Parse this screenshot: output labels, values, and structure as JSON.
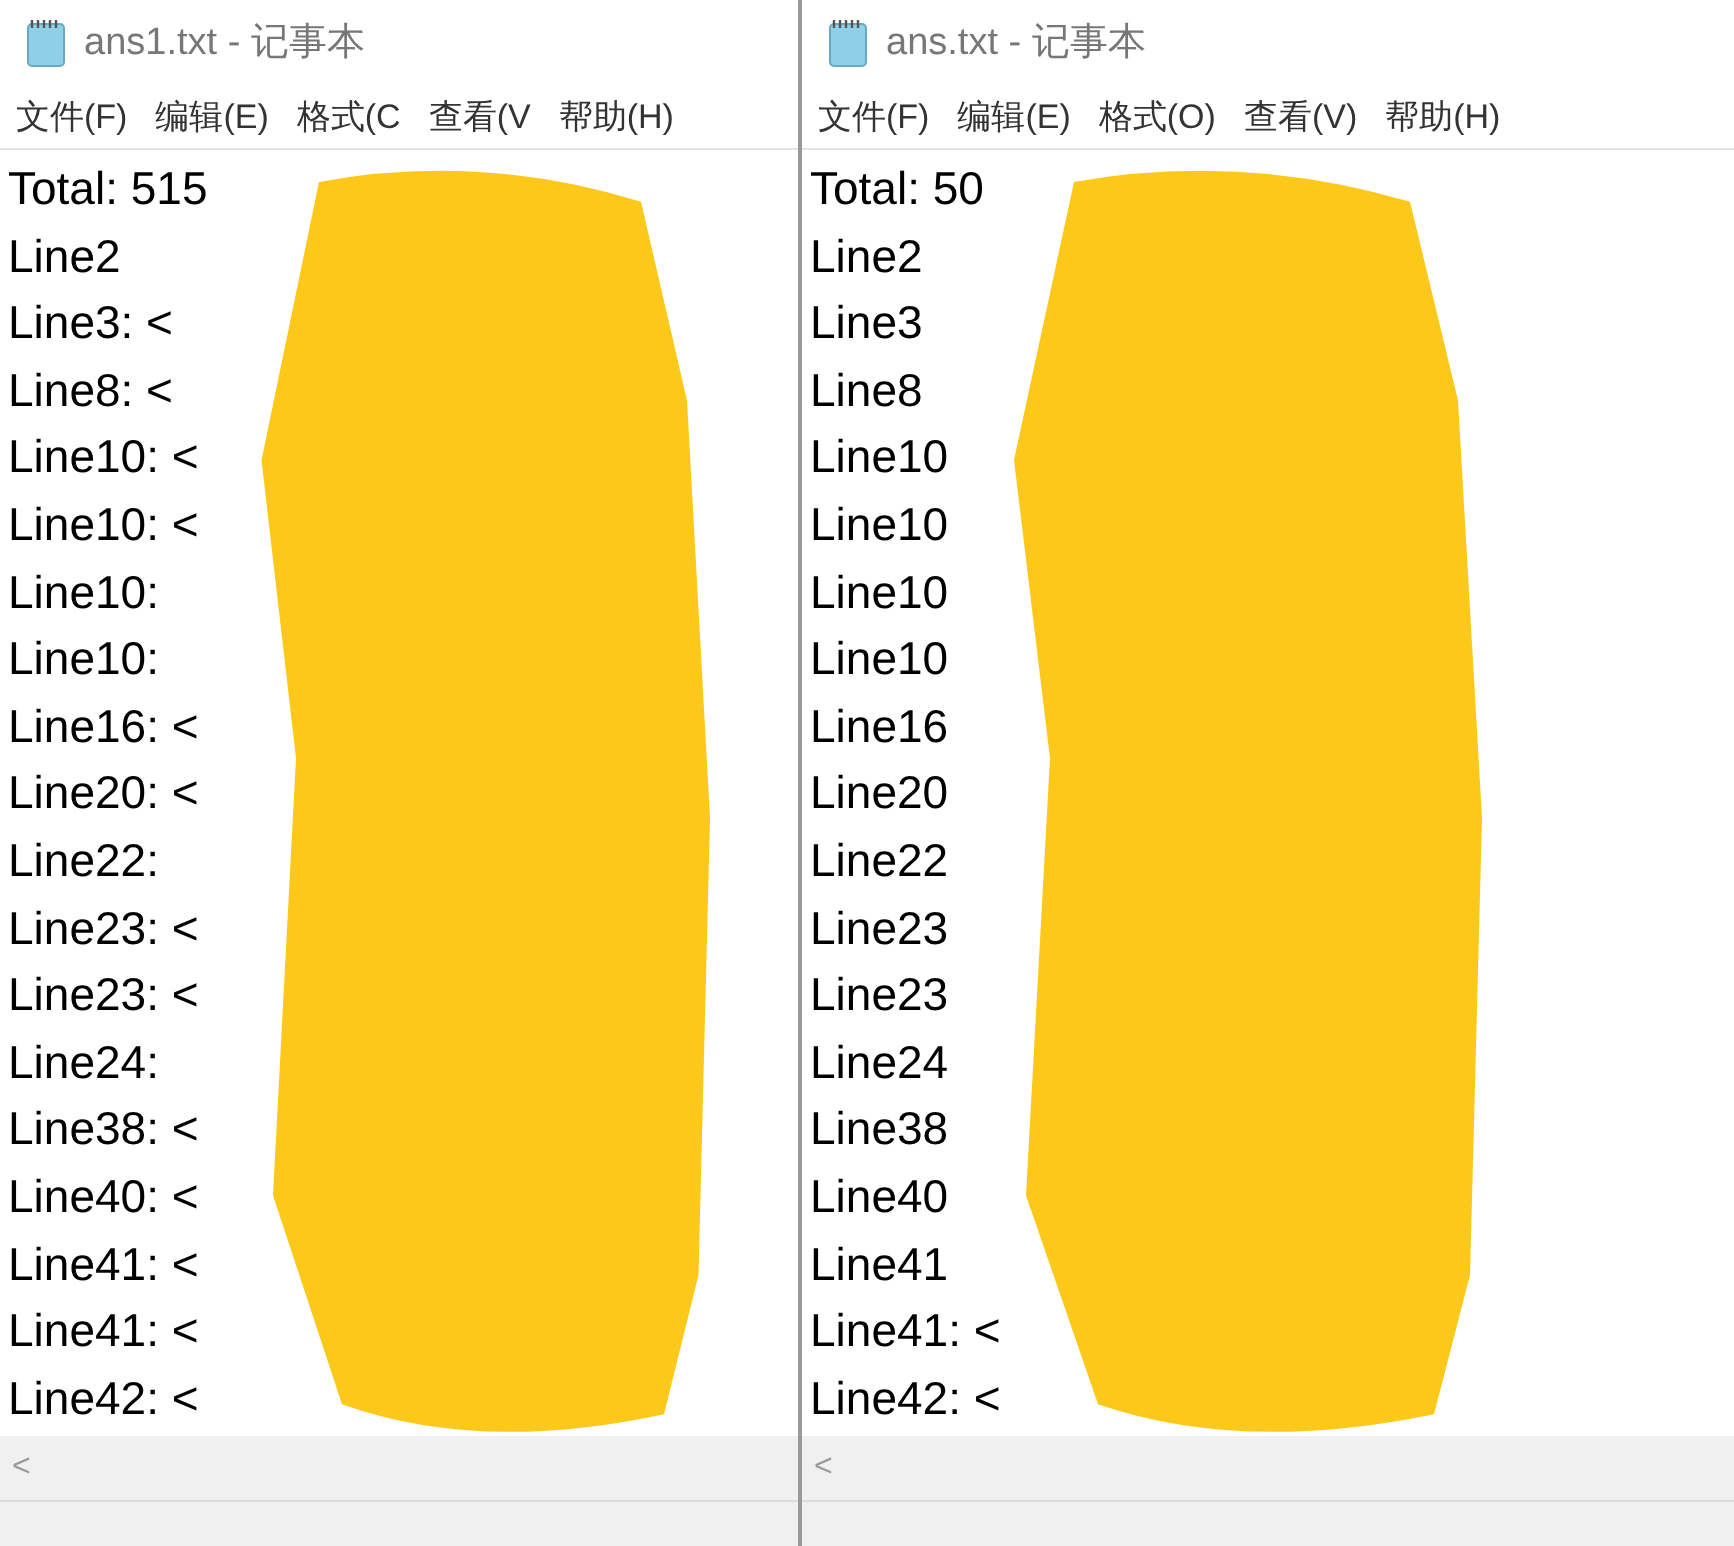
{
  "windows": [
    {
      "title": "ans1.txt - 记事本",
      "menu": [
        "文件(F)",
        "编辑(E)",
        "格式(C",
        "查看(V",
        "帮助(H)"
      ],
      "lines": [
        "Total: 515",
        "Line2",
        "Line3: <",
        "Line8: <",
        "Line10: <",
        "Line10: <",
        "Line10:",
        "Line10:",
        "Line16: <",
        "Line20: <",
        "Line22:",
        "Line23: <",
        "Line23: <",
        "Line24:",
        "Line38: <",
        "Line40: <",
        "Line41: <",
        "Line41: <",
        "Line42: <"
      ],
      "scroll_arrow": "<"
    },
    {
      "title": "ans.txt - 记事本",
      "menu": [
        "文件(F)",
        "编辑(E)",
        "格式(O)",
        "查看(V)",
        "帮助(H)"
      ],
      "lines": [
        "Total: 50",
        "Line2",
        "Line3",
        "Line8",
        "Line10",
        "Line10",
        "Line10",
        "Line10",
        "Line16",
        "Line20",
        "Line22",
        "Line23",
        "Line23",
        "Line24",
        "Line38",
        "Line40",
        "Line41",
        "Line41: <",
        "Line42: <"
      ],
      "scroll_arrow": "<"
    }
  ]
}
